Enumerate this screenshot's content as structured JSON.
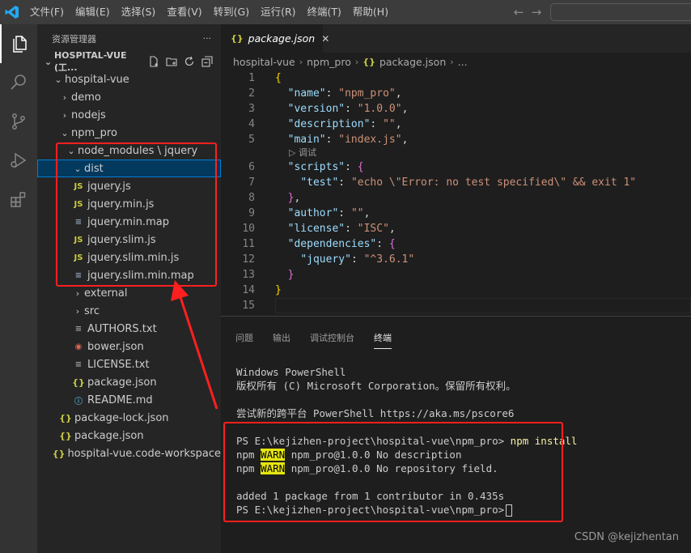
{
  "menu": [
    "文件(F)",
    "编辑(E)",
    "选择(S)",
    "查看(V)",
    "转到(G)",
    "运行(R)",
    "终端(T)",
    "帮助(H)"
  ],
  "sidebar": {
    "title": "资源管理器",
    "more": "···",
    "workspace": "HOSPITAL-VUE (工...",
    "tree": [
      {
        "label": "hospital-vue",
        "chev": "⌄",
        "icon": ""
      },
      {
        "label": "demo",
        "chev": "›",
        "icon": ""
      },
      {
        "label": "nodejs",
        "chev": "›",
        "icon": ""
      },
      {
        "label": "npm_pro",
        "chev": "⌄",
        "icon": ""
      },
      {
        "label": "node_modules \\ jquery",
        "chev": "⌄",
        "icon": ""
      },
      {
        "label": "dist",
        "chev": "⌄",
        "icon": ""
      },
      {
        "label": "jquery.js",
        "chev": "",
        "icon": "JS"
      },
      {
        "label": "jquery.min.js",
        "chev": "",
        "icon": "JS"
      },
      {
        "label": "jquery.min.map",
        "chev": "",
        "icon": "≡"
      },
      {
        "label": "jquery.slim.js",
        "chev": "",
        "icon": "JS"
      },
      {
        "label": "jquery.slim.min.js",
        "chev": "",
        "icon": "JS"
      },
      {
        "label": "jquery.slim.min.map",
        "chev": "",
        "icon": "≡"
      },
      {
        "label": "external",
        "chev": "›",
        "icon": ""
      },
      {
        "label": "src",
        "chev": "›",
        "icon": ""
      },
      {
        "label": "AUTHORS.txt",
        "chev": "",
        "icon": "≡"
      },
      {
        "label": "bower.json",
        "chev": "",
        "icon": "◉"
      },
      {
        "label": "LICENSE.txt",
        "chev": "",
        "icon": "≡"
      },
      {
        "label": "package.json",
        "chev": "",
        "icon": "{}"
      },
      {
        "label": "README.md",
        "chev": "",
        "icon": "ⓘ"
      },
      {
        "label": "package-lock.json",
        "chev": "",
        "icon": "{}"
      },
      {
        "label": "package.json",
        "chev": "",
        "icon": "{}"
      },
      {
        "label": "hospital-vue.code-workspace",
        "chev": "",
        "icon": "{}"
      }
    ]
  },
  "editor": {
    "tab_label": "package.json",
    "tab_icon": "{}",
    "close": "✕",
    "breadcrumb": [
      "hospital-vue",
      "npm_pro",
      "package.json",
      "..."
    ],
    "codelens": "调试",
    "line_numbers": [
      "1",
      "2",
      "3",
      "4",
      "5",
      "6",
      "7",
      "8",
      "9",
      "10",
      "11",
      "12",
      "13",
      "14",
      "15"
    ],
    "lines": [
      {
        "text": "{"
      },
      {
        "key": "\"name\"",
        "val": "\"npm_pro\"",
        "end": ","
      },
      {
        "key": "\"version\"",
        "val": "\"1.0.0\"",
        "end": ","
      },
      {
        "key": "\"description\"",
        "val": "\"\"",
        "end": ","
      },
      {
        "key": "\"main\"",
        "val": "\"index.js\"",
        "end": ","
      },
      {
        "key": "\"scripts\"",
        "open": "{"
      },
      {
        "key": "\"test\"",
        "val": "\"echo \\\"Error: no test specified\\\" && exit 1\"",
        "end": ""
      },
      {
        "close": "}",
        "end": ","
      },
      {
        "key": "\"author\"",
        "val": "\"\"",
        "end": ","
      },
      {
        "key": "\"license\"",
        "val": "\"ISC\"",
        "end": ","
      },
      {
        "key": "\"dependencies\"",
        "open": "{"
      },
      {
        "key": "\"jquery\"",
        "val": "\"^3.6.1\"",
        "end": ""
      },
      {
        "close": "}",
        "end": ""
      },
      {
        "text": "}"
      },
      {
        "text": ""
      }
    ]
  },
  "panel": {
    "tabs": [
      "问题",
      "输出",
      "调试控制台",
      "终端"
    ],
    "active_tab": "终端",
    "terminal": {
      "l1": "Windows PowerShell",
      "l2": "版权所有 (C) Microsoft Corporation。保留所有权利。",
      "l3": "尝试新的跨平台 PowerShell https://aka.ms/pscore6",
      "prompt": "PS E:\\kejizhen-project\\hospital-vue\\npm_pro>",
      "command": "npm install",
      "npm": "npm",
      "warn": "WARN",
      "warn1": "npm_pro@1.0.0 No description",
      "warn2": "npm_pro@1.0.0 No repository field.",
      "added": "added 1 package from 1 contributor in 0.435s",
      "prompt2": "PS E:\\kejizhen-project\\hospital-vue\\npm_pro>"
    }
  },
  "watermark": "CSDN @kejizhentan",
  "colors": {
    "accent": "#007acc",
    "annotation": "#ff1f1f",
    "warn_bg": "#e5e510"
  }
}
